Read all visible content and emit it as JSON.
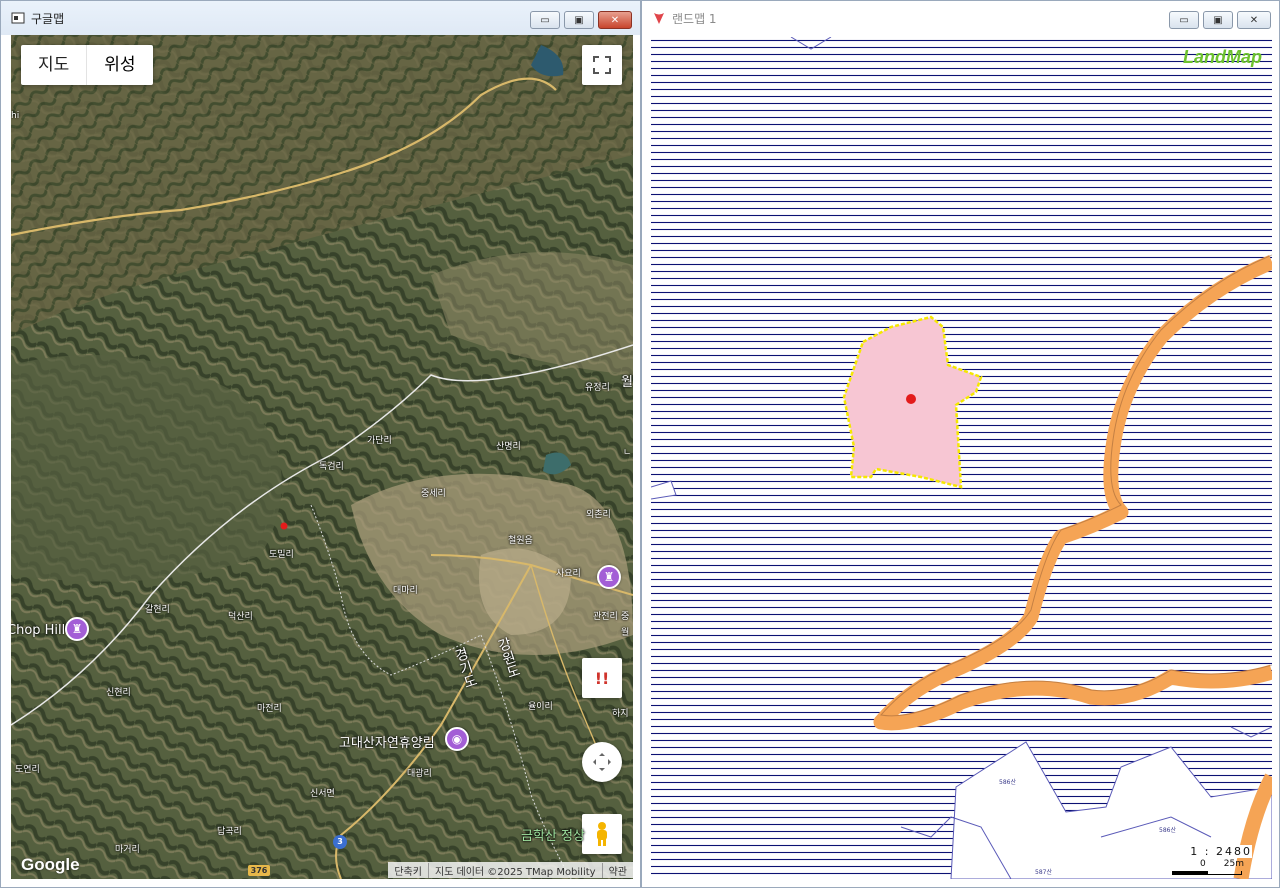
{
  "left_window": {
    "title": "구글맵",
    "buttons": {
      "minimize": "▭",
      "restore": "▣",
      "close": "✕"
    },
    "map_type": {
      "map_label": "지도",
      "satellite_label": "위성"
    },
    "controls": {
      "warning_label": "!!"
    },
    "logo": "Google",
    "attribution": [
      "단축키",
      "지도 데이터 ©2025 TMap Mobility",
      "약관"
    ],
    "road_shields": [
      "376",
      "3"
    ],
    "places": {
      "yujeong_ri": "유정리",
      "wol": "월",
      "gadan_ri": "가단리",
      "sanmyeong_ri": "산명리",
      "dokgeom_ri": "독검리",
      "jungse_ri": "중세리",
      "oechon_ri": "외촌리",
      "cheorwon_eup": "철원읍",
      "domil_ri": "도밀리",
      "sayo_ri": "사요리",
      "daema_ri": "대마리",
      "galhyeon_ri": "갈현리",
      "deoksan_ri": "덕산리",
      "gwanjeon_ri": "관전리",
      "wol2": "월",
      "chop_hill": "Chop Hill",
      "sinhyeon_ri": "신현리",
      "majeon_ri": "마전리",
      "yuli_ri": "율이리",
      "haji": "하지",
      "godaesan": "고대산자연휴양림",
      "doyeon_ri": "도연리",
      "daegwang_ri": "대광리",
      "sinseo_myeon": "신서면",
      "dapgok_ri": "답곡리",
      "mageo_ri": "마거리",
      "geumhaksan": "금학산 정상",
      "gyeonggi_do": "경기도",
      "gangwon_do": "강원도",
      "hi": "hi",
      "n": "ㄴ",
      "jung": "중"
    }
  },
  "right_window": {
    "title": "랜드맵 1",
    "buttons": {
      "minimize": "▭",
      "restore": "▣",
      "close": "✕"
    },
    "logo": "LandMap",
    "scale_text": "1 : 2480",
    "scale_zero": "0",
    "scale_value": "25m",
    "parcel_labels": [
      "586산",
      "586산",
      "587산"
    ],
    "colors": {
      "parcel_fill": "#f7c6d3",
      "parcel_outline": "#f5e800",
      "road": "#f5a455",
      "hatch": "#0c1173"
    }
  }
}
